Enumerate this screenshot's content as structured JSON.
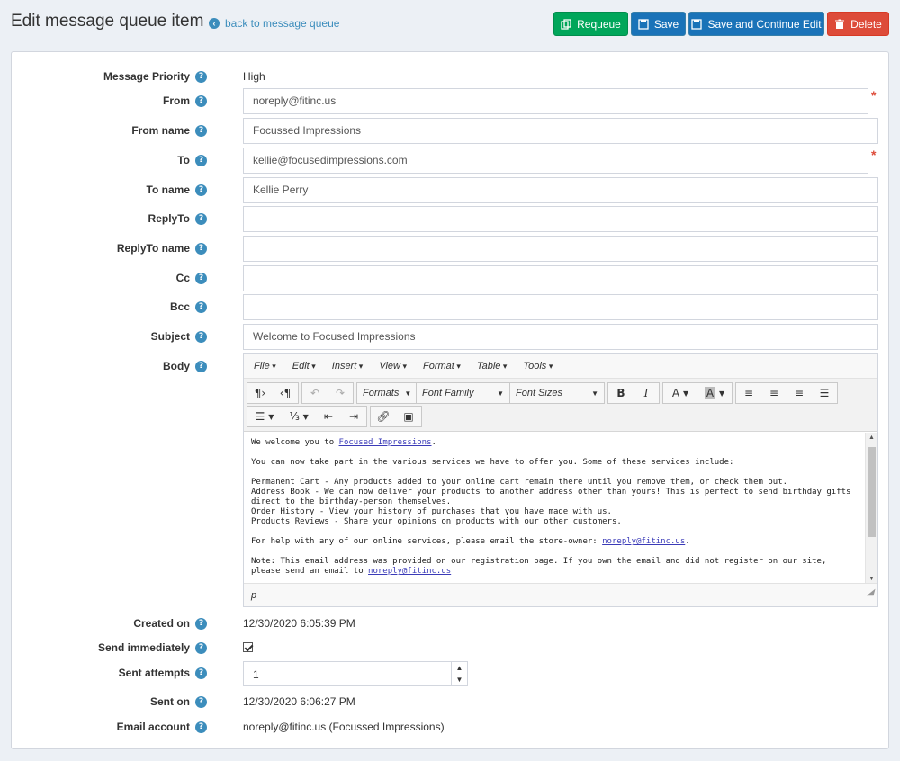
{
  "header": {
    "title": "Edit message queue item",
    "back_link": "back to message queue",
    "buttons": {
      "requeue": "Requeue",
      "save": "Save",
      "save_continue": "Save and Continue Edit",
      "delete": "Delete"
    }
  },
  "form": {
    "priority": {
      "label": "Message Priority",
      "value": "High"
    },
    "from": {
      "label": "From",
      "value": "noreply@fitinc.us"
    },
    "from_name": {
      "label": "From name",
      "value": "Focussed Impressions"
    },
    "to": {
      "label": "To",
      "value": "kellie@focusedimpressions.com"
    },
    "to_name": {
      "label": "To name",
      "value": "Kellie Perry"
    },
    "reply_to": {
      "label": "ReplyTo",
      "value": ""
    },
    "reply_to_name": {
      "label": "ReplyTo name",
      "value": ""
    },
    "cc": {
      "label": "Cc",
      "value": ""
    },
    "bcc": {
      "label": "Bcc",
      "value": ""
    },
    "subject": {
      "label": "Subject",
      "value": "Welcome to Focused Impressions"
    },
    "body": {
      "label": "Body"
    },
    "created_on": {
      "label": "Created on",
      "value": "12/30/2020 6:05:39 PM"
    },
    "send_immediately": {
      "label": "Send immediately",
      "checked": true
    },
    "sent_attempts": {
      "label": "Sent attempts",
      "value": "1"
    },
    "sent_on": {
      "label": "Sent on",
      "value": "12/30/2020 6:06:27 PM"
    },
    "email_account": {
      "label": "Email account",
      "value": "noreply@fitinc.us (Focussed Impressions)"
    }
  },
  "editor": {
    "menus": [
      "File",
      "Edit",
      "Insert",
      "View",
      "Format",
      "Table",
      "Tools"
    ],
    "selects": {
      "formats": "Formats",
      "font_family": "Font Family",
      "font_sizes": "Font Sizes"
    },
    "content": {
      "p1_text": "We welcome you to ",
      "p1_link": "Focused Impressions",
      "p1_end": ".",
      "p2": "You can now take part in the various services we have to offer you. Some of these services include:",
      "line1": "Permanent Cart - Any products added to your online cart remain there until you remove them, or check them out.",
      "line2": "Address Book - We can now deliver your products to another address other than yours! This is perfect to send birthday gifts direct to the birthday-person themselves.",
      "line3": "Order History - View your history of purchases that you have made with us.",
      "line4": "Products Reviews - Share your opinions on products with our other customers.",
      "p4_text": "For help with any of our online services, please email the store-owner: ",
      "p4_link": "noreply@fitinc.us",
      "p4_end": ".",
      "p5_text": "Note: This email address was provided on our registration page. If you own the email and did not register on our site, please send an email to ",
      "p5_link": "noreply@fitinc.us"
    },
    "status_path": "p"
  },
  "colors": {
    "green": "#00a65a",
    "blue": "#1a73b8",
    "red": "#dd4b39",
    "help": "#3c8dbc"
  }
}
